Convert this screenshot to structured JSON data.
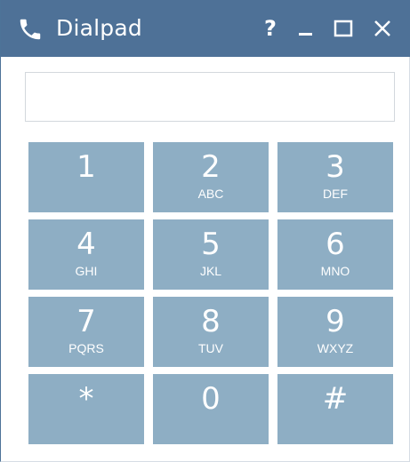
{
  "window": {
    "title": "Dialpad",
    "title_icon": "phone-icon",
    "help_label": "?",
    "minimize_icon": "minimize-icon",
    "maximize_icon": "maximize-icon",
    "close_icon": "close-icon"
  },
  "number_input": {
    "value": "",
    "placeholder": ""
  },
  "keys": [
    {
      "digit": "1",
      "letters": ""
    },
    {
      "digit": "2",
      "letters": "ABC"
    },
    {
      "digit": "3",
      "letters": "DEF"
    },
    {
      "digit": "4",
      "letters": "GHI"
    },
    {
      "digit": "5",
      "letters": "JKL"
    },
    {
      "digit": "6",
      "letters": "MNO"
    },
    {
      "digit": "7",
      "letters": "PQRS"
    },
    {
      "digit": "8",
      "letters": "TUV"
    },
    {
      "digit": "9",
      "letters": "WXYZ"
    },
    {
      "digit": "*",
      "letters": ""
    },
    {
      "digit": "0",
      "letters": ""
    },
    {
      "digit": "#",
      "letters": ""
    }
  ],
  "colors": {
    "titlebar": "#4e7197",
    "key_background": "#8eaec4",
    "key_text": "#ffffff"
  }
}
